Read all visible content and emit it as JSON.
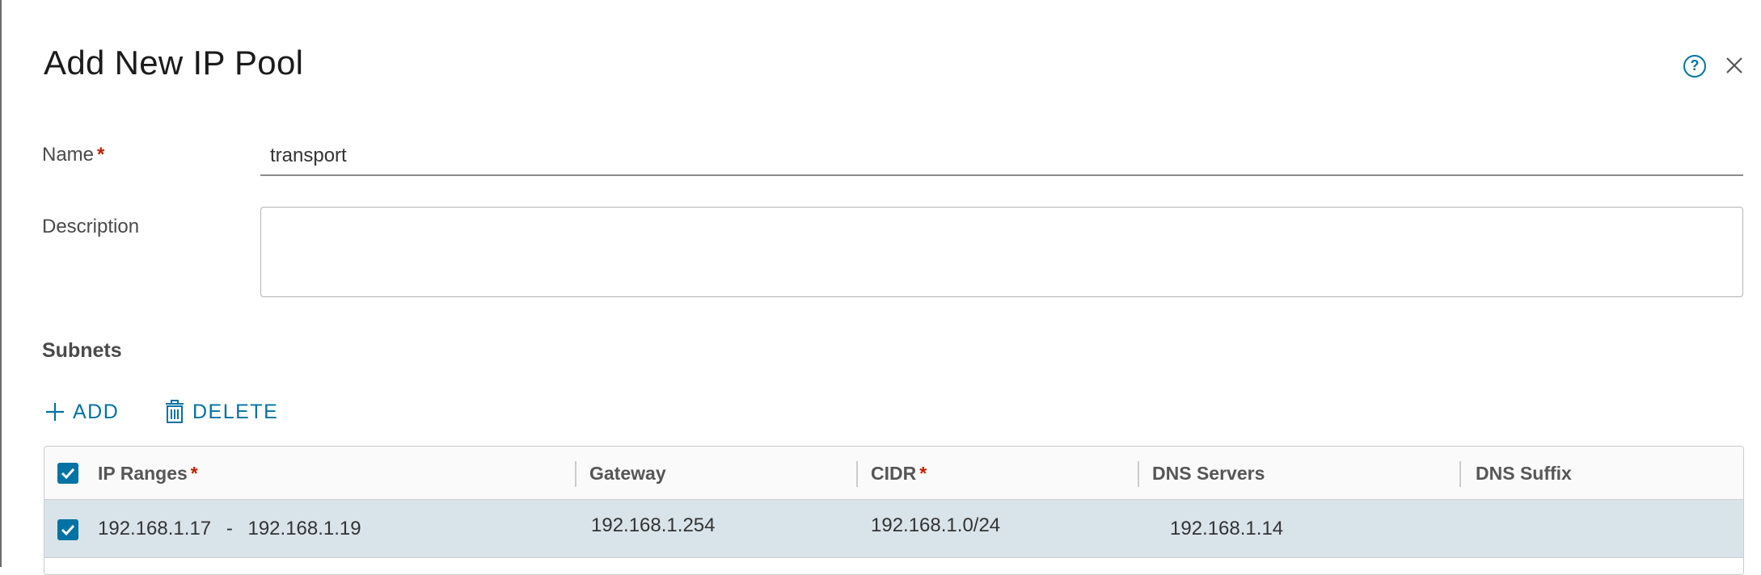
{
  "dialog": {
    "title": "Add New IP Pool",
    "help_icon": "help-circle-icon",
    "close_icon": "close-icon"
  },
  "form": {
    "name_label": "Name",
    "required_mark": "*",
    "name_value": "transport",
    "description_label": "Description",
    "description_value": ""
  },
  "subnets": {
    "title": "Subnets",
    "add_label": "ADD",
    "delete_label": "DELETE",
    "add_icon": "plus-icon",
    "delete_icon": "trash-icon",
    "columns": [
      {
        "label": "IP Ranges",
        "required": true
      },
      {
        "label": "Gateway",
        "required": false
      },
      {
        "label": "CIDR",
        "required": true
      },
      {
        "label": "DNS Servers",
        "required": false
      },
      {
        "label": "DNS Suffix",
        "required": false
      }
    ],
    "select_all_checked": true,
    "rows": [
      {
        "checked": true,
        "ip_range_start": "192.168.1.17",
        "range_separator": "-",
        "ip_range_end": "192.168.1.19",
        "gateway": "192.168.1.254",
        "cidr": "192.168.1.0/24",
        "dns_servers": "192.168.1.14",
        "dns_suffix": ""
      }
    ]
  },
  "colors": {
    "accent": "#0072a3",
    "required": "#c21d00",
    "selected_row": "#d9e4ea"
  }
}
